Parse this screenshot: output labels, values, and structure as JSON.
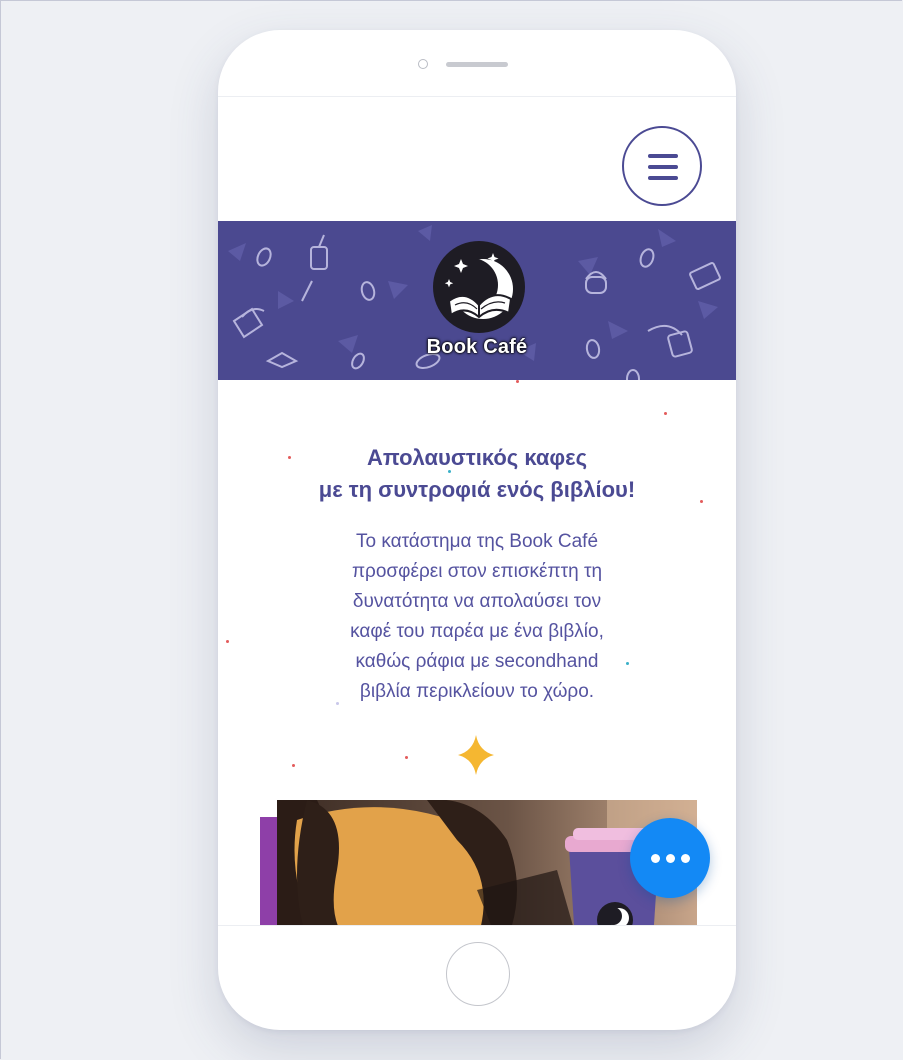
{
  "header": {
    "menu_icon": "hamburger-menu-icon"
  },
  "banner": {
    "logo_text": "Book Café",
    "background_color": "#4b4990",
    "logo_icon": "open-book-moon-icon"
  },
  "intro": {
    "headline_line1": "Απολαυστικός καφες",
    "headline_line2": "με τη συντροφιά ενός βιβλίου!",
    "body_lines": [
      "Το κατάστημα της Book Café",
      "προσφέρει στον επισκέπτη τη",
      "δυνατότητα να απολαύσει τον",
      "καφέ του παρέα με ένα βιβλίο,",
      "καθώς ράφια με secondhand",
      "βιβλία περικλείουν το χώρο."
    ],
    "divider_icon": "sparkle-star-icon",
    "accent_color": "#f5b731"
  },
  "photo": {
    "description_icon": "coffee-cup-photo",
    "accent_color": "#8e3fa8"
  },
  "chat_fab": {
    "icon": "more-dots-icon",
    "color": "#1389f5"
  },
  "theme": {
    "primary": "#4b4a93"
  }
}
